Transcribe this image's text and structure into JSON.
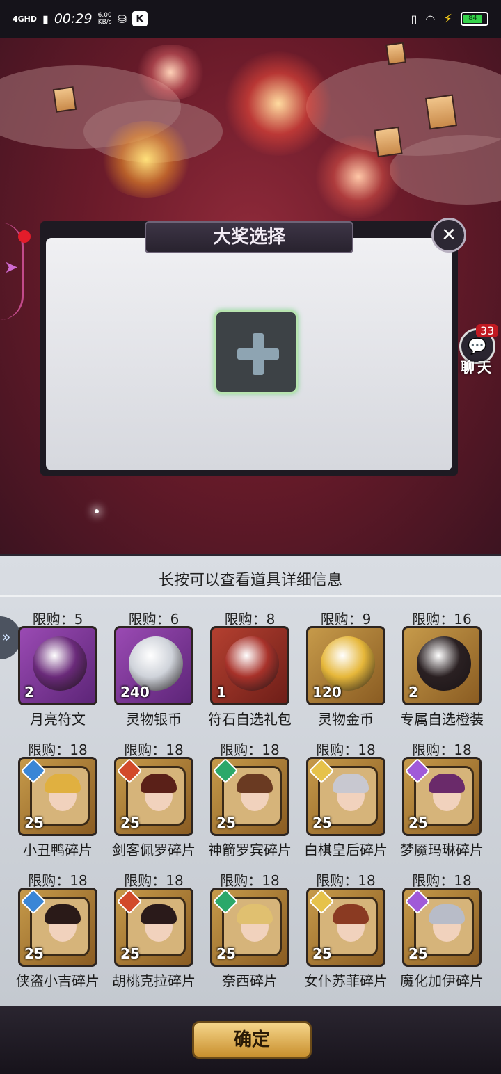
{
  "status_bar": {
    "network": "4GHD",
    "time": "00:29",
    "speed_value": "6.00",
    "speed_unit": "KB/s",
    "k_label": "K",
    "battery": "84"
  },
  "chat": {
    "badge": "33",
    "label": "聊天"
  },
  "dialog": {
    "title": "大奖选择",
    "close_icon": "close-icon",
    "add_icon": "plus-icon"
  },
  "panel": {
    "hint": "长按可以查看道具详细信息",
    "items": [
      {
        "limit_label": "限购：",
        "limit": "5",
        "qty": "2",
        "name": "月亮符文",
        "style": "purple"
      },
      {
        "limit_label": "限购：",
        "limit": "6",
        "qty": "240",
        "name": "灵物银币",
        "style": "purple"
      },
      {
        "limit_label": "限购：",
        "limit": "8",
        "qty": "1",
        "name": "符石自选礼包",
        "style": "red"
      },
      {
        "limit_label": "限购：",
        "limit": "9",
        "qty": "120",
        "name": "灵物金币",
        "style": "gold"
      },
      {
        "limit_label": "限购：",
        "limit": "16",
        "qty": "2",
        "name": "专属自选橙装",
        "style": "gold"
      },
      {
        "limit_label": "限购：",
        "limit": "18",
        "qty": "25",
        "name": "小丑鸭碎片",
        "style": "gold"
      },
      {
        "limit_label": "限购：",
        "limit": "18",
        "qty": "25",
        "name": "剑客佩罗碎片",
        "style": "gold"
      },
      {
        "limit_label": "限购：",
        "limit": "18",
        "qty": "25",
        "name": "神箭罗宾碎片",
        "style": "gold"
      },
      {
        "limit_label": "限购：",
        "limit": "18",
        "qty": "25",
        "name": "白棋皇后碎片",
        "style": "gold"
      },
      {
        "limit_label": "限购：",
        "limit": "18",
        "qty": "25",
        "name": "梦魇玛琳碎片",
        "style": "gold"
      },
      {
        "limit_label": "限购：",
        "limit": "18",
        "qty": "25",
        "name": "侠盗小吉碎片",
        "style": "gold"
      },
      {
        "limit_label": "限购：",
        "limit": "18",
        "qty": "25",
        "name": "胡桃克拉碎片",
        "style": "gold"
      },
      {
        "limit_label": "限购：",
        "limit": "18",
        "qty": "25",
        "name": "奈西碎片",
        "style": "gold"
      },
      {
        "limit_label": "限购：",
        "limit": "18",
        "qty": "25",
        "name": "女仆苏菲碎片",
        "style": "gold"
      },
      {
        "limit_label": "限购：",
        "limit": "18",
        "qty": "25",
        "name": "魔化加伊碎片",
        "style": "gold"
      }
    ]
  },
  "confirm_button": "确定",
  "colors": {
    "background_red": "#8f2a3a",
    "panel_bg": "#d9dde3",
    "confirm_gold": "#e2b35a",
    "badge_red": "#c11a22"
  }
}
